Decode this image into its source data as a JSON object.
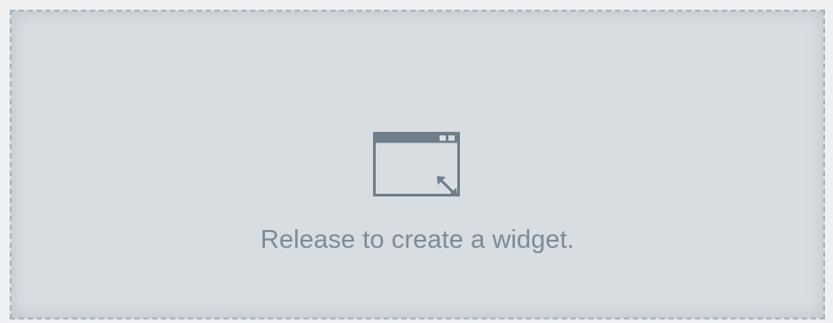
{
  "drop_zone": {
    "message": "Release to create a widget.",
    "icon": "widget-window-resize-icon",
    "colors": {
      "background": "#d8dde1",
      "border": "#a7b0b8",
      "icon": "#6e7e8b",
      "text": "#7d8b97"
    }
  }
}
